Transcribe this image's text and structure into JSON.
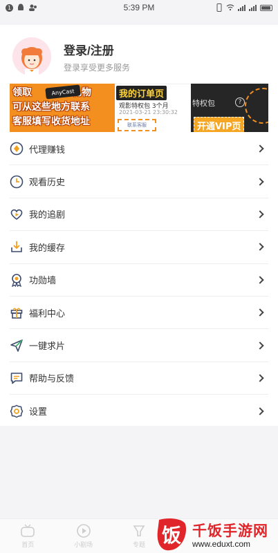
{
  "status_bar": {
    "time": "5:39 PM",
    "notif_badge": "1"
  },
  "profile": {
    "title": "登录/注册",
    "subtitle": "登录享受更多服务"
  },
  "banners": {
    "b1": {
      "line1": "领取",
      "line1b": "礼物",
      "line2": "可从这些地方联系",
      "line3": "客服填写收货地址",
      "chip": "AnyCast"
    },
    "b2": {
      "tag": "我的订单页",
      "item": "观影特权包 3个月",
      "date": "2021-03-21 23:30:32",
      "button": "联系客服",
      "corner": "32"
    },
    "b3": {
      "text": "特权包",
      "vip": "开通VIP页",
      "q": "?"
    }
  },
  "menu": {
    "items": [
      {
        "label": "代理赚钱",
        "icon": "diamond-icon"
      },
      {
        "label": "观看历史",
        "icon": "clock-icon"
      },
      {
        "label": "我的追剧",
        "icon": "heart-play-icon"
      },
      {
        "label": "我的缓存",
        "icon": "download-icon"
      },
      {
        "label": "功勋墙",
        "icon": "medal-icon"
      },
      {
        "label": "福利中心",
        "icon": "gift-icon"
      },
      {
        "label": "一键求片",
        "icon": "paper-plane-icon"
      },
      {
        "label": "帮助与反馈",
        "icon": "chat-icon"
      },
      {
        "label": "设置",
        "icon": "gear-icon"
      }
    ]
  },
  "tabbar": {
    "tabs": [
      {
        "label": "首页",
        "icon": "tv-icon"
      },
      {
        "label": "小剧场",
        "icon": "play-circle-icon"
      },
      {
        "label": "专题",
        "icon": "cup-icon"
      }
    ]
  },
  "watermark": {
    "name": "千饭手游网",
    "url": "www.eduxt.com",
    "logo_char": "饭"
  },
  "colors": {
    "accent": "#f28f1f",
    "background": "#f4f4f6",
    "watermark_red": "#e0262a"
  }
}
